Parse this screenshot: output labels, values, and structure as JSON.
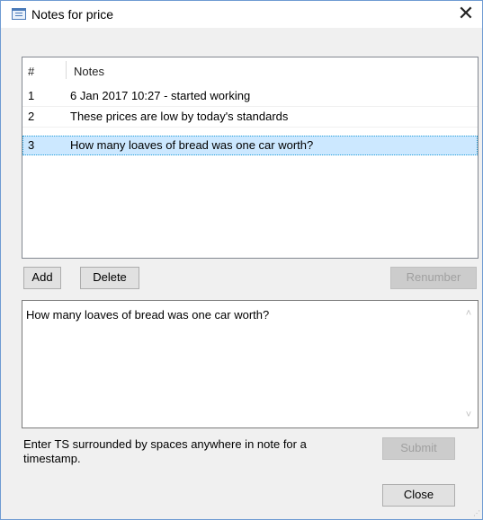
{
  "window": {
    "title": "Notes for price",
    "close_glyph": "✕"
  },
  "icons": {
    "app": "notes-window-icon",
    "close": "close-icon"
  },
  "list": {
    "columns": [
      "#",
      "Notes"
    ],
    "rows": [
      {
        "num": "1",
        "note": "6 Jan 2017 10:27 - started working"
      },
      {
        "num": "2",
        "note": "These prices are low by today's standards"
      },
      {
        "num": "3",
        "note": "How many loaves of bread was one car worth?"
      }
    ],
    "selected_index": 2
  },
  "buttons": {
    "add": "Add",
    "delete": "Delete",
    "renumber": "Renumber",
    "submit": "Submit",
    "close": "Close"
  },
  "editor": {
    "value": "How many loaves of bread was one car worth?",
    "scroll_up_glyph": "˄",
    "scroll_down_glyph": "˅"
  },
  "hint": "Enter TS surrounded by spaces anywhere in note for a timestamp.",
  "colors": {
    "selection": "#cce8ff",
    "window_border": "#6f9bd2"
  }
}
